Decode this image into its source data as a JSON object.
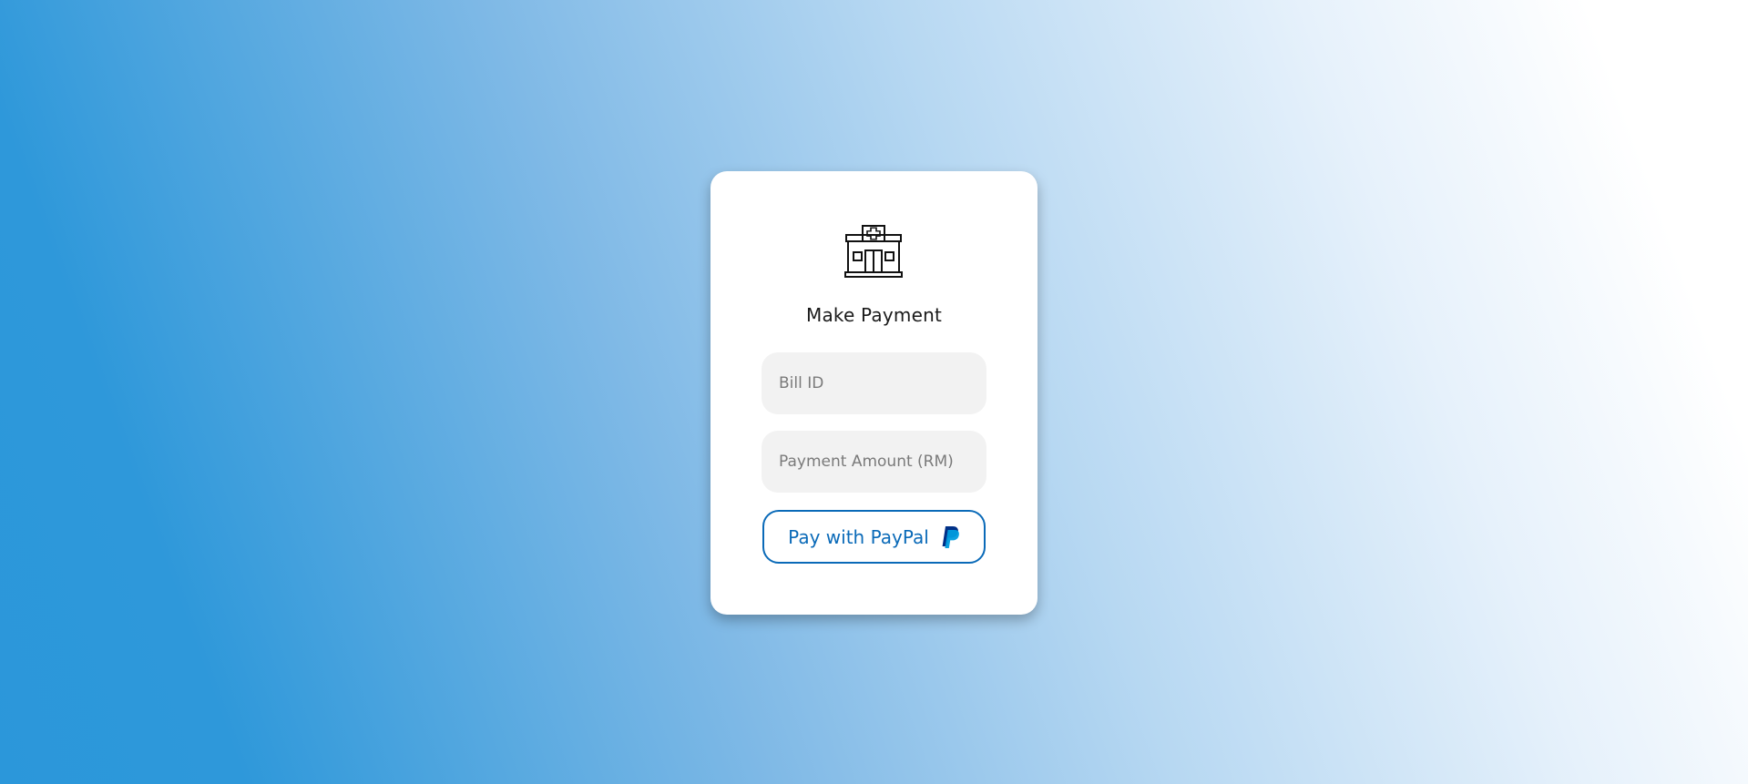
{
  "card": {
    "logo_icon": "hospital-building-icon",
    "title": "Make Payment"
  },
  "form": {
    "bill_id": {
      "placeholder": "Bill ID",
      "value": ""
    },
    "payment_amount": {
      "placeholder": "Payment Amount (RM)",
      "value": ""
    },
    "pay_button": {
      "label": "Pay with PayPal",
      "icon": "paypal-icon"
    }
  },
  "colors": {
    "background_start": "#2b97da",
    "background_end": "#ffffff",
    "card_background": "#ffffff",
    "input_background": "#f2f2f2",
    "paypal_blue": "#0a6ab8",
    "paypal_dark": "#003087",
    "paypal_light": "#009cde"
  }
}
